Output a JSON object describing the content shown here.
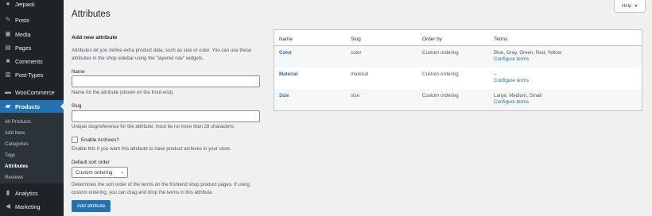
{
  "sidebar": {
    "items": [
      {
        "label": "Jetpack",
        "icon": "jetpack-icon"
      },
      {
        "label": "Posts",
        "icon": "pin-icon"
      },
      {
        "label": "Media",
        "icon": "media-icon"
      },
      {
        "label": "Pages",
        "icon": "pages-icon"
      },
      {
        "label": "Comments",
        "icon": "comment-icon"
      },
      {
        "label": "Post Types",
        "icon": "post-types-icon"
      },
      {
        "label": "WooCommerce",
        "icon": "woocommerce-icon"
      },
      {
        "label": "Products",
        "icon": "products-icon"
      },
      {
        "label": "Analytics",
        "icon": "analytics-icon"
      },
      {
        "label": "Marketing",
        "icon": "marketing-icon"
      }
    ],
    "submenu": [
      "All Products",
      "Add New",
      "Categories",
      "Tags",
      "Attributes",
      "Reviews"
    ]
  },
  "header": {
    "title": "Attributes",
    "help": "Help"
  },
  "form": {
    "heading": "Add new attribute",
    "intro": "Attributes let you define extra product data, such as size or color. You can use these attributes in the shop sidebar using the \"layered nav\" widgets.",
    "name_label": "Name",
    "name_value": "",
    "name_help": "Name for the attribute (shown on the front-end).",
    "slug_label": "Slug",
    "slug_value": "",
    "slug_help": "Unique slug/reference for the attribute; must be no more than 28 characters.",
    "archives_label": "Enable Archives?",
    "archives_help": "Enable this if you want this attribute to have product archives in your store.",
    "sort_label": "Default sort order",
    "sort_value": "Custom ordering",
    "sort_help": "Determines the sort order of the terms on the frontend shop product pages. If using custom ordering, you can drag and drop the terms in this attribute.",
    "submit": "Add attribute"
  },
  "table": {
    "headers": [
      "Name",
      "Slug",
      "Order by",
      "Terms"
    ],
    "rows": [
      {
        "name": "Color",
        "slug": "color",
        "order": "Custom ordering",
        "terms": "Blue, Gray, Green, Red, Yellow",
        "configure": "Configure terms"
      },
      {
        "name": "Material",
        "slug": "material",
        "order": "Custom ordering",
        "terms": "–",
        "configure": "Configure terms"
      },
      {
        "name": "Size",
        "slug": "size",
        "order": "Custom ordering",
        "terms": "Large, Medium, Small",
        "configure": "Configure terms"
      }
    ]
  },
  "colors": {
    "sidebar_bg": "#1d2327",
    "accent": "#2271b1",
    "page_bg": "#f0f0f1"
  }
}
